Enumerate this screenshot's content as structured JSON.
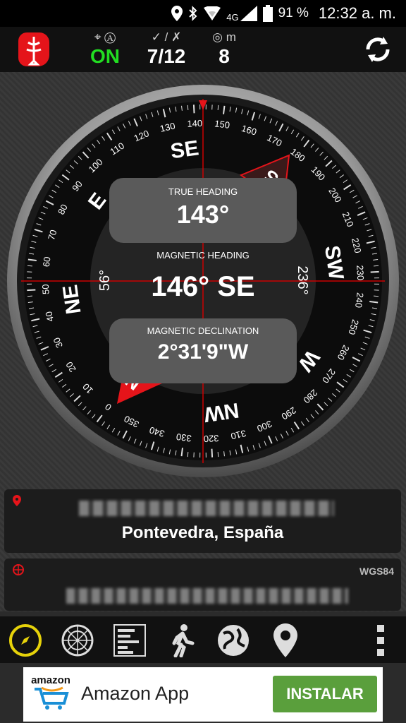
{
  "status_bar": {
    "battery": "91 %",
    "network": "4G",
    "time": "12:32 a. m."
  },
  "top_bar": {
    "gps_status": "ON",
    "satellites": "7/12",
    "accuracy": "8",
    "accuracy_unit": "m",
    "colors": {
      "on": "#22dd22",
      "logo": "#e5141a"
    }
  },
  "compass": {
    "true_heading_label": "TRUE HEADING",
    "true_heading": "143°",
    "magnetic_heading_label": "MAGNETIC HEADING",
    "magnetic_heading": "146° SE",
    "declination_label": "MAGNETIC DECLINATION",
    "declination": "2°31'9\"W",
    "left_angle": "56°",
    "right_angle": "236°",
    "degree_labels": [
      "0",
      "10",
      "20",
      "30",
      "40",
      "50",
      "60",
      "70",
      "80",
      "90",
      "100",
      "110",
      "120",
      "130",
      "140",
      "150",
      "160",
      "170",
      "180",
      "190",
      "200",
      "210",
      "220",
      "230",
      "240",
      "250",
      "260",
      "270",
      "280",
      "290",
      "300",
      "310",
      "320",
      "330",
      "340",
      "350"
    ],
    "directions": [
      "N",
      "NE",
      "E",
      "SE",
      "S",
      "SW",
      "W",
      "NW"
    ]
  },
  "location": {
    "address_line2": "Pontevedra, España",
    "datum": "WGS84"
  },
  "bottom_nav": [
    "compass-icon",
    "radar-icon",
    "list-icon",
    "walk-icon",
    "globe-icon",
    "pin-icon",
    "more-icon"
  ],
  "ad": {
    "brand": "amazon",
    "title": "Amazon App",
    "button": "INSTALAR",
    "button_color": "#5a9f3c"
  }
}
